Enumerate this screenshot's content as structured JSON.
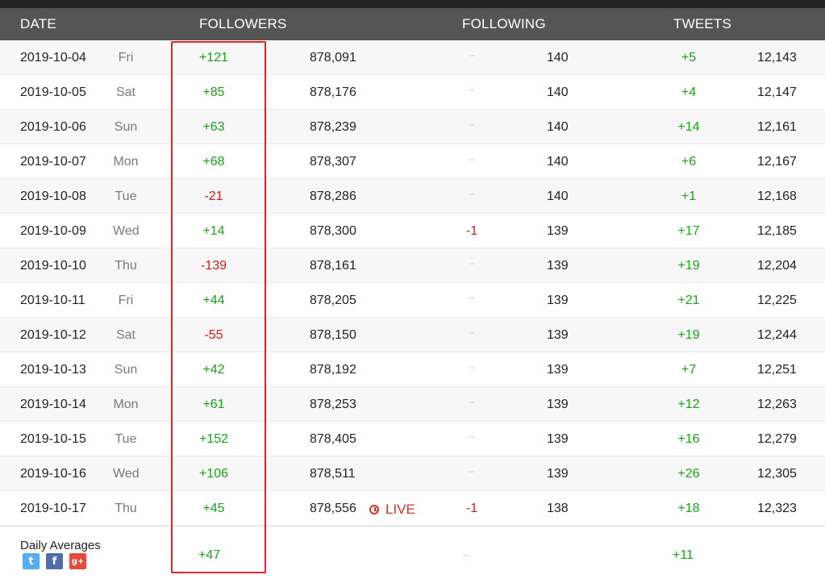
{
  "header": {
    "date": "DATE",
    "followers": "FOLLOWERS",
    "following": "FOLLOWING",
    "tweets": "TWEETS"
  },
  "colors": {
    "positive": "#16a316",
    "negative": "#d91a1a",
    "live": "#d9311f",
    "highlight": "#e02525"
  },
  "rows": [
    {
      "date": "2019-10-04",
      "day": "Fri",
      "followers_delta": "+121",
      "followers_total": "878,091",
      "live": "",
      "following_delta": "--",
      "following_total": "140",
      "tweets_delta": "+5",
      "tweets_total": "12,143"
    },
    {
      "date": "2019-10-05",
      "day": "Sat",
      "followers_delta": "+85",
      "followers_total": "878,176",
      "live": "",
      "following_delta": "--",
      "following_total": "140",
      "tweets_delta": "+4",
      "tweets_total": "12,147"
    },
    {
      "date": "2019-10-06",
      "day": "Sun",
      "followers_delta": "+63",
      "followers_total": "878,239",
      "live": "",
      "following_delta": "--",
      "following_total": "140",
      "tweets_delta": "+14",
      "tweets_total": "12,161"
    },
    {
      "date": "2019-10-07",
      "day": "Mon",
      "followers_delta": "+68",
      "followers_total": "878,307",
      "live": "",
      "following_delta": "--",
      "following_total": "140",
      "tweets_delta": "+6",
      "tweets_total": "12,167"
    },
    {
      "date": "2019-10-08",
      "day": "Tue",
      "followers_delta": "-21",
      "followers_total": "878,286",
      "live": "",
      "following_delta": "--",
      "following_total": "140",
      "tweets_delta": "+1",
      "tweets_total": "12,168"
    },
    {
      "date": "2019-10-09",
      "day": "Wed",
      "followers_delta": "+14",
      "followers_total": "878,300",
      "live": "",
      "following_delta": "-1",
      "following_total": "139",
      "tweets_delta": "+17",
      "tweets_total": "12,185"
    },
    {
      "date": "2019-10-10",
      "day": "Thu",
      "followers_delta": "-139",
      "followers_total": "878,161",
      "live": "",
      "following_delta": "--",
      "following_total": "139",
      "tweets_delta": "+19",
      "tweets_total": "12,204"
    },
    {
      "date": "2019-10-11",
      "day": "Fri",
      "followers_delta": "+44",
      "followers_total": "878,205",
      "live": "",
      "following_delta": "--",
      "following_total": "139",
      "tweets_delta": "+21",
      "tweets_total": "12,225"
    },
    {
      "date": "2019-10-12",
      "day": "Sat",
      "followers_delta": "-55",
      "followers_total": "878,150",
      "live": "",
      "following_delta": "--",
      "following_total": "139",
      "tweets_delta": "+19",
      "tweets_total": "12,244"
    },
    {
      "date": "2019-10-13",
      "day": "Sun",
      "followers_delta": "+42",
      "followers_total": "878,192",
      "live": "",
      "following_delta": "--",
      "following_total": "139",
      "tweets_delta": "+7",
      "tweets_total": "12,251"
    },
    {
      "date": "2019-10-14",
      "day": "Mon",
      "followers_delta": "+61",
      "followers_total": "878,253",
      "live": "",
      "following_delta": "--",
      "following_total": "139",
      "tweets_delta": "+12",
      "tweets_total": "12,263"
    },
    {
      "date": "2019-10-15",
      "day": "Tue",
      "followers_delta": "+152",
      "followers_total": "878,405",
      "live": "",
      "following_delta": "--",
      "following_total": "139",
      "tweets_delta": "+16",
      "tweets_total": "12,279"
    },
    {
      "date": "2019-10-16",
      "day": "Wed",
      "followers_delta": "+106",
      "followers_total": "878,511",
      "live": "",
      "following_delta": "--",
      "following_total": "139",
      "tweets_delta": "+26",
      "tweets_total": "12,305"
    },
    {
      "date": "2019-10-17",
      "day": "Thu",
      "followers_delta": "+45",
      "followers_total": "878,556",
      "live": "LIVE",
      "following_delta": "-1",
      "following_total": "138",
      "tweets_delta": "+18",
      "tweets_total": "12,323"
    }
  ],
  "averages": {
    "label": "Daily Averages",
    "followers": "+47",
    "following": "--",
    "tweets": "+11"
  },
  "share_icons": [
    "twitter-icon",
    "facebook-icon",
    "google-plus-icon"
  ],
  "share_glyphs": {
    "twitter": "t",
    "facebook": "f",
    "google_plus": "g+"
  }
}
